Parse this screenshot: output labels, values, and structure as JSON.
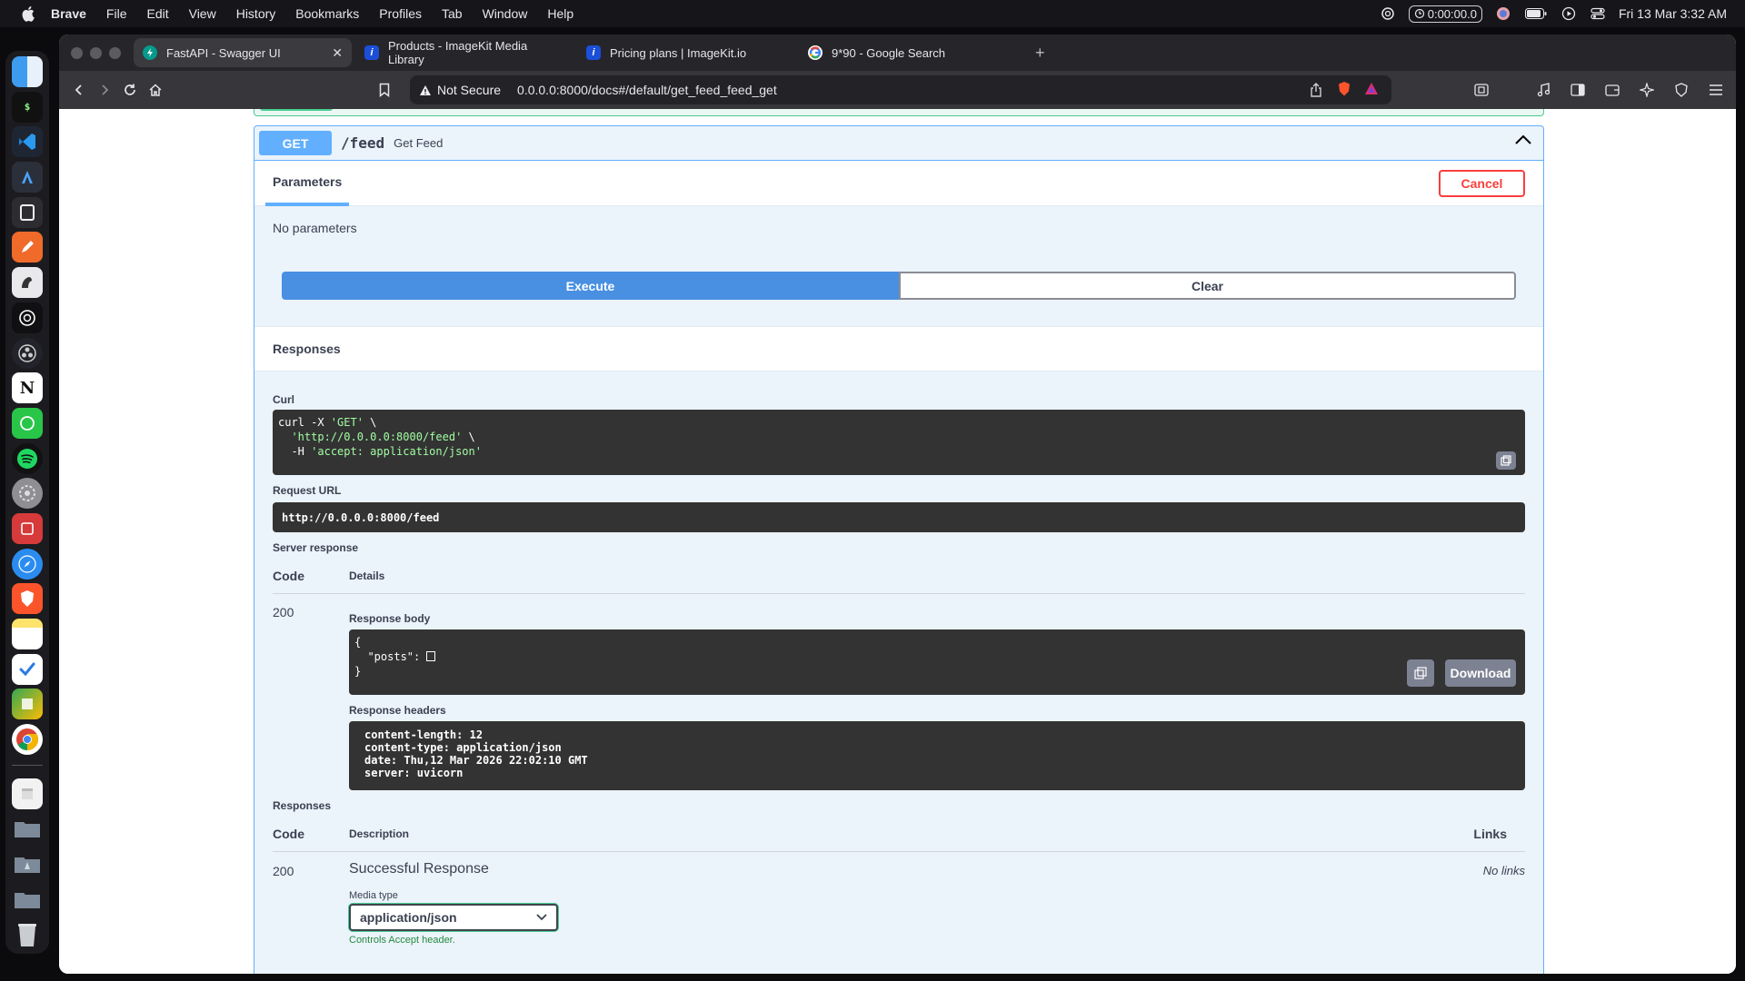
{
  "menubar": {
    "app": "Brave",
    "items": [
      "File",
      "Edit",
      "View",
      "History",
      "Bookmarks",
      "Profiles",
      "Tab",
      "Window",
      "Help"
    ],
    "timer": "0:00:00.0",
    "clock": "Fri 13 Mar  3:32 AM"
  },
  "tabs": [
    {
      "title": "FastAPI - Swagger UI",
      "icon": "fastapi-icon",
      "active": true
    },
    {
      "title": "Products - ImageKit Media Library",
      "icon": "imagekit-icon"
    },
    {
      "title": "Pricing plans | ImageKit.io",
      "icon": "imagekit-icon"
    },
    {
      "title": "9*90 - Google Search",
      "icon": "google-icon"
    }
  ],
  "address": {
    "security": "Not Secure",
    "url": "0.0.0.0:8000/docs#/default/get_feed_feed_get"
  },
  "operation": {
    "method": "GET",
    "path": "/feed",
    "summary": "Get Feed",
    "params_tab": "Parameters",
    "cancel": "Cancel",
    "no_params": "No parameters",
    "execute": "Execute",
    "clear": "Clear",
    "responses_title": "Responses"
  },
  "curl": {
    "label": "Curl",
    "line1_cmd": "curl -X ",
    "line1_method": "'GET'",
    "line1_end": " \\",
    "line2_url": "'http://0.0.0.0:8000/feed'",
    "line2_end": " \\",
    "line3_flag": "-H ",
    "line3_header": "'accept: application/json'"
  },
  "request_url": {
    "label": "Request URL",
    "value": "http://0.0.0.0:8000/feed"
  },
  "server_response": {
    "label": "Server response",
    "code_header": "Code",
    "details_header": "Details",
    "code": "200",
    "body_label": "Response body",
    "body_line1": "{",
    "body_key": "\"posts\": ",
    "body_line3": "}",
    "download": "Download",
    "headers_label": "Response headers",
    "headers": [
      "content-length: 12",
      "content-type: application/json",
      "date: Thu,12 Mar 2026 22:02:10 GMT",
      "server: uvicorn"
    ]
  },
  "responses": {
    "label": "Responses",
    "code_header": "Code",
    "desc_header": "Description",
    "links_header": "Links",
    "code": "200",
    "description": "Successful Response",
    "links": "No links",
    "media_type_label": "Media type",
    "media_type": "application/json",
    "controls_note": "Controls Accept header."
  },
  "colors": {
    "get": "#61affe",
    "execute": "#4990e2",
    "cancel": "#f93e3e",
    "success": "#49cc90"
  }
}
